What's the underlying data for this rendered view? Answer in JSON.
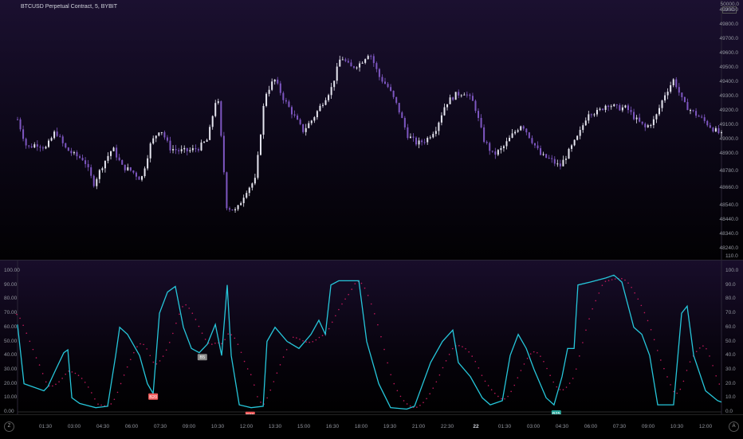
{
  "header": {
    "title": "BTCUSD Perpetual Contract, 5, BYBIT",
    "currency": "USD"
  },
  "price_axis": {
    "labels": [
      49900,
      49800,
      49700,
      49600,
      49500,
      49400,
      49300,
      49200,
      49100,
      49000,
      48900,
      48780,
      48660,
      48540,
      48440,
      48340,
      48240
    ],
    "top_label": "50000.0"
  },
  "osc_axis": {
    "left_labels": [
      "100.00",
      "90.00",
      "80.00",
      "70.00",
      "60.00",
      "50.00",
      "40.00",
      "30.00",
      "20.00",
      "10.00",
      "0.00"
    ],
    "right_labels": [
      "110.0",
      "100.0",
      "90.0",
      "80.0",
      "70.0",
      "60.0",
      "50.0",
      "40.0",
      "30.0",
      "20.0",
      "10.0",
      "0.0"
    ]
  },
  "time_axis": {
    "labels": [
      "01:30",
      "03:00",
      "04:30",
      "06:00",
      "07:30",
      "09:00",
      "10:30",
      "12:00",
      "13:30",
      "15:00",
      "16:30",
      "18:00",
      "19:30",
      "21:00",
      "22:30",
      "22",
      "01:30",
      "03:00",
      "04:30",
      "06:00",
      "07:30",
      "09:00",
      "10:30",
      "12:00"
    ],
    "left_button": "Z",
    "right_button": "A"
  },
  "colors": {
    "oscillator": "#26c6da",
    "signal": "#c2185b",
    "candle_up": "#e6e6f0",
    "candle_down": "#7e57c2",
    "marker_red": "#f05a5a",
    "marker_gray": "#8a8a8a",
    "marker_teal": "#26a69a"
  },
  "chart_data": [
    {
      "type": "candlestick",
      "title": "BTCUSD Perpetual Contract, 5, BYBIT",
      "ylabel": "USD",
      "ylim": [
        48240,
        49950
      ],
      "x_unit": "equally spaced samples over ~36h",
      "closes": [
        49140,
        48940,
        48970,
        48940,
        49060,
        48940,
        48890,
        48860,
        48690,
        48830,
        48940,
        48810,
        48780,
        48720,
        48970,
        49080,
        48940,
        48920,
        48920,
        48940,
        49000,
        49330,
        48530,
        48500,
        48640,
        48720,
        49310,
        49420,
        49280,
        49170,
        49060,
        49140,
        49250,
        49360,
        49580,
        49500,
        49530,
        49610,
        49440,
        49360,
        49220,
        49030,
        48970,
        49000,
        49080,
        49250,
        49310,
        49330,
        49250,
        49000,
        48890,
        48940,
        49030,
        49110,
        49000,
        48890,
        48860,
        48810,
        48920,
        49030,
        49190,
        49190,
        49250,
        49220,
        49220,
        49140,
        49080,
        49140,
        49310,
        49420,
        49250,
        49190,
        49140,
        49080,
        49030
      ]
    },
    {
      "type": "line",
      "xlabel": "hours",
      "ylabel": "",
      "ylim": [
        0,
        100
      ],
      "series": [
        {
          "name": "oscillator",
          "points": [
            [
              0.04,
              62
            ],
            [
              0.38,
              20
            ],
            [
              1,
              17
            ],
            [
              1.42,
              15
            ],
            [
              1.63,
              18
            ],
            [
              2.04,
              30
            ],
            [
              2.46,
              42
            ],
            [
              2.67,
              44
            ],
            [
              2.88,
              10
            ],
            [
              3.29,
              6
            ],
            [
              4.13,
              3
            ],
            [
              4.75,
              4
            ],
            [
              5.17,
              40
            ],
            [
              5.38,
              60
            ],
            [
              5.79,
              55
            ],
            [
              6.42,
              40
            ],
            [
              6.83,
              20
            ],
            [
              7.13,
              13
            ],
            [
              7.46,
              70
            ],
            [
              7.88,
              85
            ],
            [
              8.29,
              89
            ],
            [
              8.71,
              60
            ],
            [
              9.13,
              45
            ],
            [
              9.54,
              42
            ],
            [
              9.96,
              48
            ],
            [
              10.38,
              62
            ],
            [
              10.71,
              40
            ],
            [
              11,
              90
            ],
            [
              11.21,
              40
            ],
            [
              11.63,
              5
            ],
            [
              12.25,
              3
            ],
            [
              12.88,
              4
            ],
            [
              13.08,
              50
            ],
            [
              13.5,
              60
            ],
            [
              14.13,
              50
            ],
            [
              14.75,
              45
            ],
            [
              15.38,
              55
            ],
            [
              15.79,
              65
            ],
            [
              16.13,
              55
            ],
            [
              16.42,
              90
            ],
            [
              16.83,
              93
            ],
            [
              17.88,
              93
            ],
            [
              18.29,
              50
            ],
            [
              18.92,
              20
            ],
            [
              19.54,
              3
            ],
            [
              20.38,
              2
            ],
            [
              20.79,
              4
            ],
            [
              21.63,
              35
            ],
            [
              22.25,
              50
            ],
            [
              22.79,
              58
            ],
            [
              23.08,
              35
            ],
            [
              23.71,
              25
            ],
            [
              24.33,
              10
            ],
            [
              24.75,
              5
            ],
            [
              25.38,
              8
            ],
            [
              25.79,
              40
            ],
            [
              26.21,
              55
            ],
            [
              26.63,
              45
            ],
            [
              27.04,
              30
            ],
            [
              27.67,
              10
            ],
            [
              28.08,
              5
            ],
            [
              28.5,
              25
            ],
            [
              28.79,
              45
            ],
            [
              29.13,
              45
            ],
            [
              29.33,
              90
            ],
            [
              29.96,
              92
            ],
            [
              30.79,
              95
            ],
            [
              31.21,
              97
            ],
            [
              31.63,
              92
            ],
            [
              32.25,
              60
            ],
            [
              32.67,
              55
            ],
            [
              33.08,
              40
            ],
            [
              33.5,
              5
            ],
            [
              34.33,
              5
            ],
            [
              34.75,
              70
            ],
            [
              35.04,
              75
            ],
            [
              35.38,
              40
            ],
            [
              36,
              15
            ],
            [
              36.63,
              8
            ],
            [
              36.83,
              7
            ]
          ]
        },
        {
          "name": "signal",
          "smoothing": "moving average of oscillator"
        }
      ],
      "markers": [
        {
          "label": "B20",
          "t": 7.13,
          "value": 12,
          "color": "red"
        },
        {
          "label": "B5",
          "t": 9.7,
          "value": 40,
          "color": "gray"
        },
        {
          "label": "B30",
          "t": 12.2,
          "value": -1,
          "color": "red"
        },
        {
          "label": "B25",
          "t": 28.2,
          "value": 0,
          "color": "teal"
        }
      ]
    }
  ]
}
